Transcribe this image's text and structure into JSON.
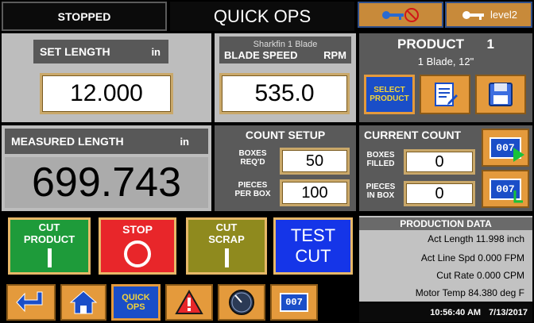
{
  "header": {
    "status": "STOPPED",
    "title": "QUICK OPS",
    "level_label": "level2"
  },
  "set_length": {
    "label": "SET LENGTH",
    "unit": "in",
    "value": "12.000"
  },
  "blade": {
    "sub_label": "Sharkfin 1 Blade",
    "label": "BLADE SPEED",
    "unit": "RPM",
    "value": "535.0"
  },
  "product": {
    "label": "PRODUCT",
    "number": "1",
    "description": "1 Blade, 12\"",
    "select_label_1": "SELECT",
    "select_label_2": "PRODUCT"
  },
  "measured": {
    "label": "MEASURED LENGTH",
    "unit": "in",
    "value": "699.743"
  },
  "count_setup": {
    "title": "COUNT SETUP",
    "boxes_label_1": "BOXES",
    "boxes_label_2": "REQ'D",
    "boxes_value": "50",
    "pieces_label_1": "PIECES",
    "pieces_label_2": "PER BOX",
    "pieces_value": "100"
  },
  "current_count": {
    "title": "CURRENT COUNT",
    "boxes_label_1": "BOXES",
    "boxes_label_2": "FILLED",
    "boxes_value": "0",
    "pieces_label_1": "PIECES",
    "pieces_label_2": "IN BOX",
    "pieces_value": "0",
    "counter_icon_text": "007"
  },
  "buttons": {
    "cut_product_1": "CUT",
    "cut_product_2": "PRODUCT",
    "stop": "STOP",
    "cut_scrap_1": "CUT",
    "cut_scrap_2": "SCRAP",
    "test_1": "TEST",
    "test_2": "CUT"
  },
  "production": {
    "title": "PRODUCTION DATA",
    "act_length": "Act Length  11.998 inch",
    "line_spd": "Act Line Spd  0.000 FPM",
    "cut_rate": "Cut Rate  0.000 CPM",
    "motor_temp": "Motor Temp  84.380 deg F"
  },
  "nav": {
    "quick_ops_1": "QUICK",
    "quick_ops_2": "OPS",
    "counter_text": "007"
  },
  "footer": {
    "time": "10:56:40 AM",
    "date": "7/13/2017"
  },
  "colors": {
    "accent_orange": "#e49a3c",
    "cut_green": "#1e9b3a",
    "stop_red": "#e8262a",
    "scrap_olive": "#8f8a1e",
    "test_blue": "#1535e8"
  }
}
